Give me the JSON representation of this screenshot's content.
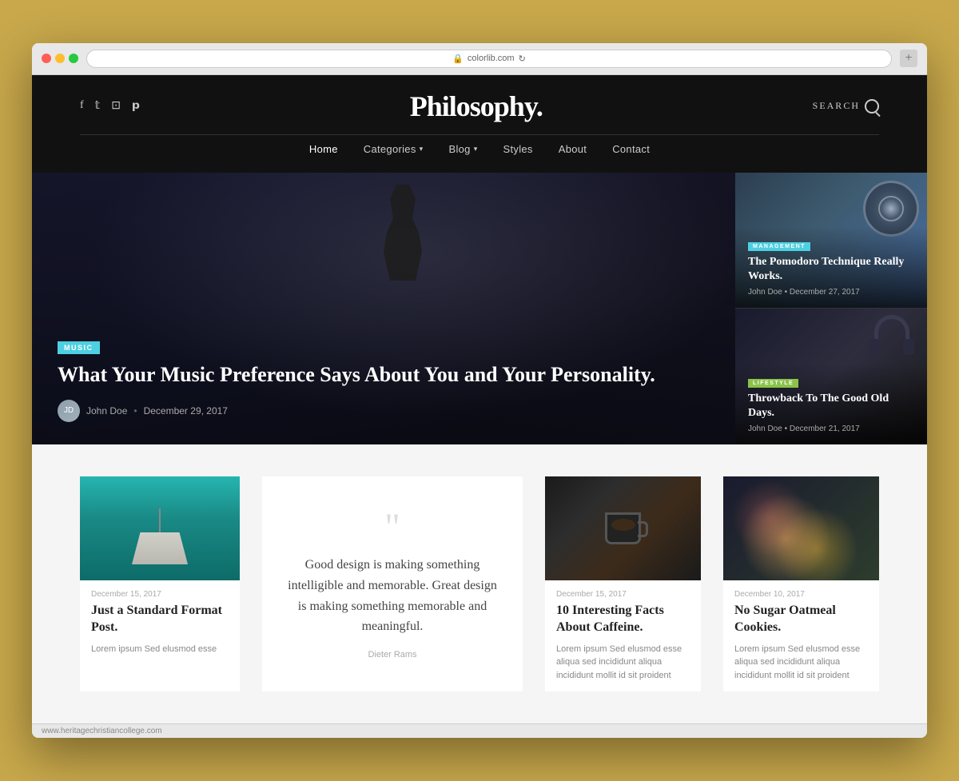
{
  "browser": {
    "address": "colorlib.com",
    "reload_icon": "↻",
    "status_bar": "www.heritagechristiancollege.com"
  },
  "header": {
    "title": "Philosophy.",
    "search_label": "SEARCH",
    "social_icons": [
      "f",
      "𝕥",
      "📷",
      "𝗽"
    ],
    "nav_items": [
      {
        "label": "Home",
        "active": true
      },
      {
        "label": "Categories",
        "has_arrow": true
      },
      {
        "label": "Blog",
        "has_arrow": true
      },
      {
        "label": "Styles"
      },
      {
        "label": "About"
      },
      {
        "label": "Contact"
      }
    ]
  },
  "hero": {
    "main_article": {
      "category": "MUSIC",
      "title": "What Your Music Preference Says About You and Your Personality.",
      "author": "John Doe",
      "date": "December 29, 2017",
      "author_dot": "•"
    },
    "side_articles": [
      {
        "category": "MANAGEMENT",
        "title": "The Pomodoro Technique Really Works.",
        "author": "John Doe",
        "date": "December 27, 2017",
        "dot": "•"
      },
      {
        "category": "LIFESTYLE",
        "title": "Throwback To The Good Old Days.",
        "author": "John Doe",
        "date": "December 21, 2017",
        "dot": "•"
      }
    ]
  },
  "posts": [
    {
      "type": "image",
      "date": "December 15, 2017",
      "title": "Just a Standard Format Post.",
      "excerpt": "Lorem ipsum Sed elusmod esse"
    },
    {
      "type": "quote",
      "quote_mark": "““",
      "quote_text": "Good design is making something intelligible and memorable. Great design is making something memorable and meaningful.",
      "quote_author": "Dieter Rams"
    },
    {
      "type": "image",
      "date": "December 15, 2017",
      "title": "10 Interesting Facts About Caffeine.",
      "excerpt": "Lorem ipsum Sed elusmod esse aliqua sed incididunt aliqua incididunt mollit id sit proident"
    },
    {
      "type": "image",
      "date": "December 10, 2017",
      "title": "No Sugar Oatmeal Cookies.",
      "excerpt": "Lorem ipsum Sed elusmod esse aliqua sed incididunt aliqua incididunt mollit id sit proident"
    }
  ]
}
